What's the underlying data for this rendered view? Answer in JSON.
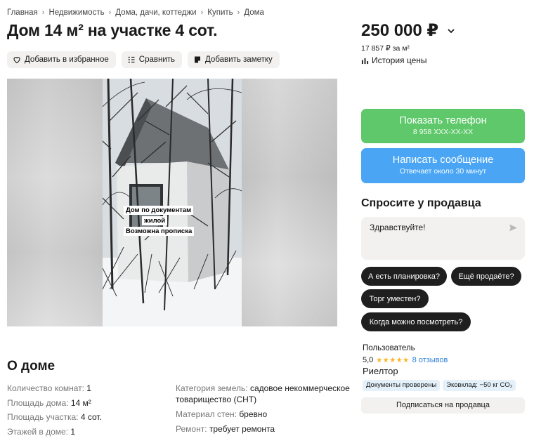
{
  "breadcrumb": [
    "Главная",
    "Недвижимость",
    "Дома, дачи, коттеджи",
    "Купить",
    "Дома"
  ],
  "title": "Дом 14 м² на участке 4 сот.",
  "actions": {
    "favorite": "Добавить в избранное",
    "compare": "Сравнить",
    "note": "Добавить заметку"
  },
  "photo_caption": {
    "line1": "Дом по документам",
    "line2": "жилой",
    "line3": "Возможна прописка"
  },
  "about": {
    "title": "О доме",
    "left": [
      {
        "label": "Количество комнат:",
        "value": "1"
      },
      {
        "label": "Площадь дома:",
        "value": "14 м²"
      },
      {
        "label": "Площадь участка:",
        "value": "4 сот."
      },
      {
        "label": "Этажей в доме:",
        "value": "1"
      }
    ],
    "right": [
      {
        "label": "Категория земель:",
        "value": "садовое некоммерческое товарищество (СНТ)"
      },
      {
        "label": "Материал стен:",
        "value": "бревно"
      },
      {
        "label": "Ремонт:",
        "value": "требует ремонта"
      }
    ]
  },
  "price": {
    "value": "250 000 ₽",
    "per_m2": "17 857 ₽ за м²",
    "history": "История цены"
  },
  "contact": {
    "phone_label": "Показать телефон",
    "phone_masked": "8 958 XXX-XX-XX",
    "message_label": "Написать сообщение",
    "message_sub": "Отвечает около 30 минут"
  },
  "ask": {
    "title": "Спросите у продавца",
    "text": "Здравствуйте!",
    "chips": [
      "А есть планировка?",
      "Ещё продаёте?",
      "Торг уместен?",
      "Когда можно посмотреть?"
    ]
  },
  "seller": {
    "label": "Пользователь",
    "rating": "5,0",
    "stars": "★★★★★",
    "reviews": "8 отзывов",
    "type": "Риелтор",
    "badges": [
      "Документы проверены",
      "Эковклад: −50 кг CO₂"
    ],
    "subscribe": "Подписаться на продавца"
  },
  "colors": {
    "phone_button": "#5ec86a",
    "message_button": "#4aa6f5",
    "chip": "#1f1f1f",
    "star": "#ffb021",
    "link": "#2f7fd6"
  }
}
